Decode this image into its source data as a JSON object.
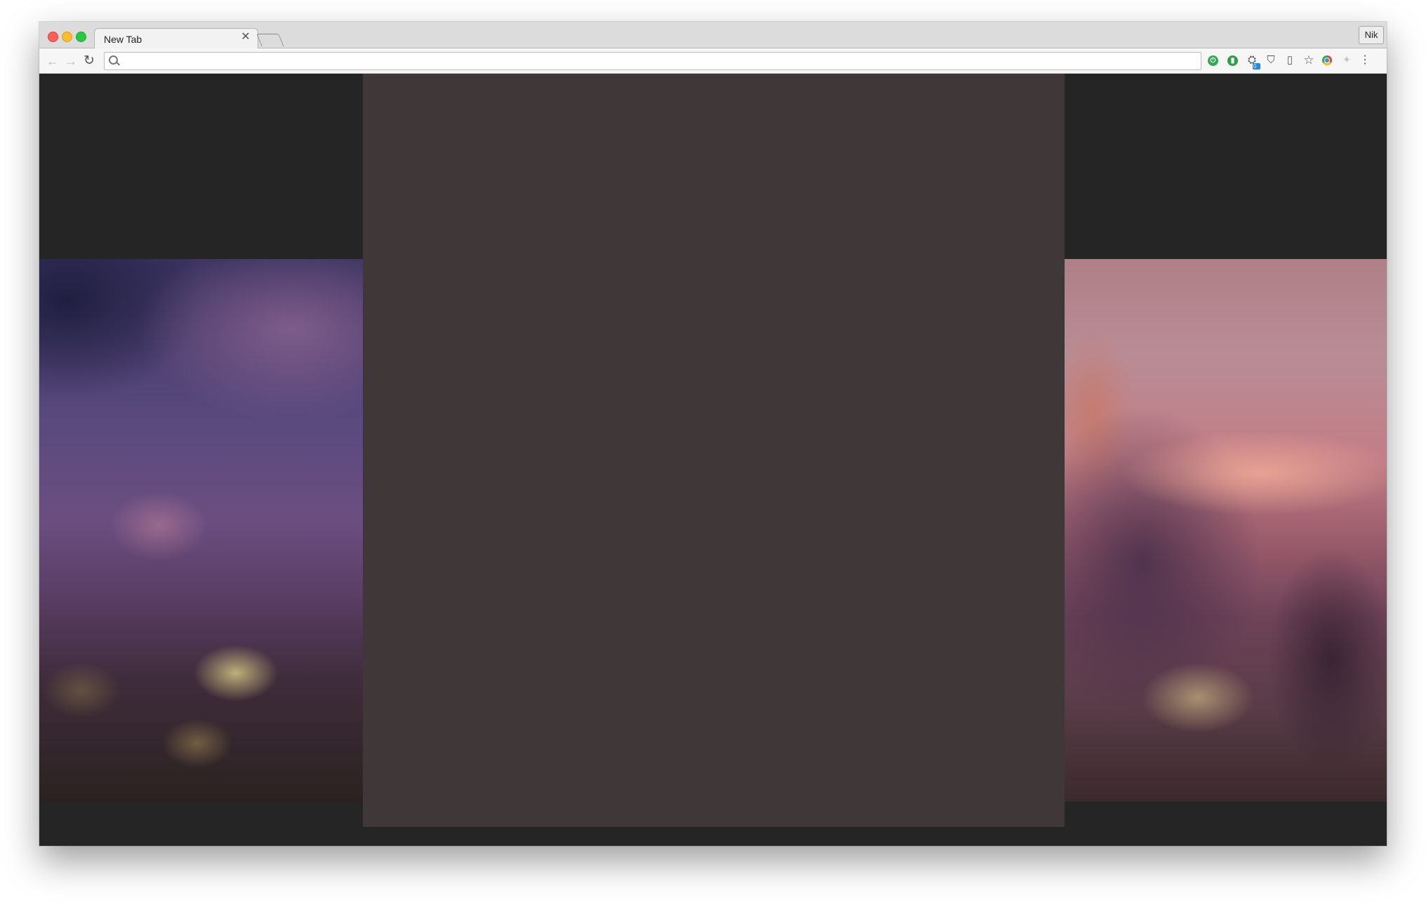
{
  "browser": {
    "tab": {
      "title": "New Tab",
      "close_glyph": "✕"
    },
    "profile_label": "Nik",
    "nav": {
      "back_glyph": "←",
      "forward_glyph": "→",
      "reload_glyph": "↻"
    },
    "omnibox": {
      "value": "",
      "placeholder": ""
    },
    "extensions": [
      {
        "name": "extension-green-power-icon",
        "glyph": "⏻"
      },
      {
        "name": "extension-green-circle-icon",
        "glyph": "▮"
      },
      {
        "name": "extension-people-icon",
        "glyph": "⛭",
        "badge": "0"
      },
      {
        "name": "extension-shield-icon",
        "glyph": "⛉"
      },
      {
        "name": "extension-battery-icon",
        "glyph": "▯"
      },
      {
        "name": "bookmark-star-icon",
        "glyph": "☆"
      },
      {
        "name": "extension-chrome-icon",
        "glyph": ""
      },
      {
        "name": "extension-puzzle-icon",
        "glyph": "✦"
      },
      {
        "name": "menu-kebab-icon",
        "glyph": "⋮"
      }
    ]
  },
  "colors": {
    "page_background": "#252525",
    "center_panel": "#403739",
    "tabstrip": "#dcdcdc",
    "toolbar": "#f6f6f6"
  }
}
